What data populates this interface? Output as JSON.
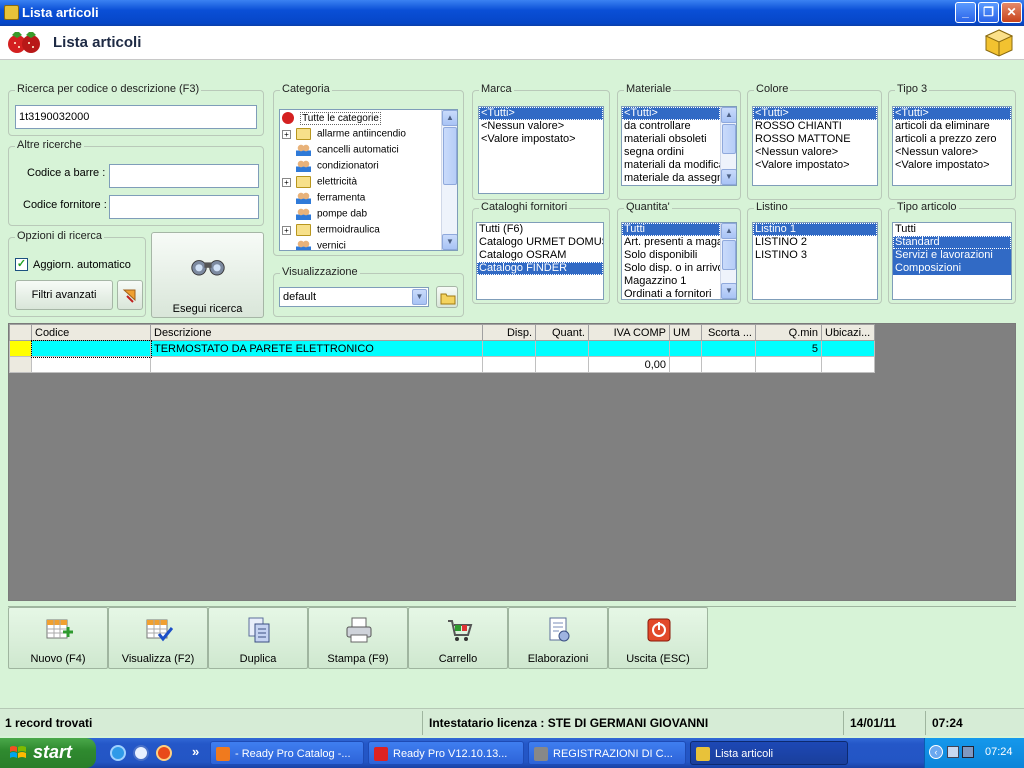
{
  "window": {
    "title": "Lista articoli",
    "minimize": "_",
    "maximize": "❐",
    "close": "✕"
  },
  "header": {
    "title": "Lista articoli"
  },
  "search": {
    "legend": "Ricerca per codice o descrizione (F3)",
    "value": "1t3190032000",
    "other_legend": "Altre ricerche",
    "barcode_label": "Codice a barre :",
    "barcode_value": "",
    "supplier_code_label": "Codice fornitore :",
    "supplier_code_value": "",
    "options_legend": "Opzioni di ricerca",
    "auto_update_label": "Aggiorn. automatico",
    "auto_update_checked": true,
    "advanced_filters_label": "Filtri avanzati",
    "execute_label": "Esegui ricerca"
  },
  "categoria": {
    "legend": "Categoria",
    "root": "Tutte le categorie",
    "items": [
      {
        "label": "allarme antiincendio",
        "type": "folder",
        "expandable": true
      },
      {
        "label": "cancelli automatici",
        "type": "people",
        "expandable": false
      },
      {
        "label": "condizionatori",
        "type": "people",
        "expandable": false
      },
      {
        "label": "elettricità",
        "type": "folder",
        "expandable": true
      },
      {
        "label": "ferramenta",
        "type": "people",
        "expandable": false
      },
      {
        "label": "pompe dab",
        "type": "people",
        "expandable": false
      },
      {
        "label": "termoidraulica",
        "type": "folder",
        "expandable": true
      },
      {
        "label": "vernici",
        "type": "people",
        "expandable": false
      }
    ]
  },
  "visualizzazione": {
    "legend": "Visualizzazione",
    "value": "default"
  },
  "marca": {
    "legend": "Marca",
    "items": [
      "<Tutti>",
      "<Nessun valore>",
      "<Valore impostato>"
    ],
    "selected": [
      0
    ]
  },
  "materiale": {
    "legend": "Materiale",
    "items": [
      "<Tutti>",
      "da controllare",
      "materiali obsoleti",
      "segna ordini",
      "materiali da modifica",
      "materiale da assegn"
    ],
    "selected": [
      0
    ]
  },
  "colore": {
    "legend": "Colore",
    "items": [
      "<Tutti>",
      "ROSSO CHIANTI",
      "ROSSO MATTONE",
      "<Nessun valore>",
      "<Valore impostato>"
    ],
    "selected": [
      0
    ]
  },
  "tipo3": {
    "legend": "Tipo 3",
    "items": [
      "<Tutti>",
      "articoli da eliminare",
      "articoli a prezzo zero",
      "<Nessun valore>",
      "<Valore impostato>"
    ],
    "selected": [
      0
    ]
  },
  "cataloghi": {
    "legend": "Cataloghi fornitori",
    "items": [
      "Tutti (F6)",
      "Catalogo URMET DOMUS",
      "Catalogo OSRAM",
      "Catalogo FINDER"
    ],
    "selected": [
      3
    ]
  },
  "quantita": {
    "legend": "Quantita'",
    "items": [
      "Tutti",
      "Art. presenti a maga",
      "Solo disponibili",
      "Solo disp. o in arrivo",
      "Magazzino 1",
      "Ordinati a fornitori"
    ],
    "selected": [
      0
    ]
  },
  "listino": {
    "legend": "Listino",
    "items": [
      "Listino 1",
      "LISTINO 2",
      "LISTINO 3"
    ],
    "selected": [
      0
    ]
  },
  "tipo_articolo": {
    "legend": "Tipo articolo",
    "items": [
      "Tutti",
      "Standard",
      "Servizi e lavorazioni",
      "Composizioni"
    ],
    "selected": [
      1,
      2,
      3
    ]
  },
  "grid": {
    "columns": [
      "Codice",
      "Descrizione",
      "Disp.",
      "Quant.",
      "IVA COMP",
      "UM",
      "Scorta ...",
      "Q.min",
      "Ubicazi..."
    ],
    "rows": [
      [
        "",
        "TERMOSTATO DA PARETE ELETTRONICO",
        "",
        "",
        "",
        "",
        "",
        "5",
        ""
      ]
    ],
    "totals": [
      "",
      "",
      "",
      "",
      "0,00",
      "",
      "",
      "",
      ""
    ]
  },
  "toolbar": {
    "buttons": [
      {
        "label": "Nuovo (F4)",
        "icon": "new-grid-icon"
      },
      {
        "label": "Visualizza (F2)",
        "icon": "view-grid-icon"
      },
      {
        "label": "Duplica",
        "icon": "duplicate-icon"
      },
      {
        "label": "Stampa (F9)",
        "icon": "printer-icon"
      },
      {
        "label": "Carrello",
        "icon": "cart-icon"
      },
      {
        "label": "Elaborazioni",
        "icon": "process-icon"
      },
      {
        "label": "Uscita (ESC)",
        "icon": "exit-icon"
      }
    ]
  },
  "status": {
    "records": "1 record trovati",
    "license": "Intestatario licenza : STE DI GERMANI GIOVANNI",
    "date": "14/01/11",
    "time": "07:24"
  },
  "taskbar": {
    "start": "start",
    "more": "»",
    "tasks": [
      {
        "label": "- Ready Pro Catalog -...",
        "color": "#f07a1e",
        "active": false
      },
      {
        "label": "Ready Pro V12.10.13...",
        "color": "#d22",
        "active": false
      },
      {
        "label": "REGISTRAZIONI DI C...",
        "color": "#888",
        "active": false
      },
      {
        "label": "Lista articoli",
        "color": "#e8c23a",
        "active": true
      }
    ],
    "clock": "07:24"
  },
  "colors": {
    "selection": "#316ac5",
    "current_row": "#00ffff",
    "row_marker": "#ffff00",
    "panel_bg": "#d7f3d7"
  }
}
